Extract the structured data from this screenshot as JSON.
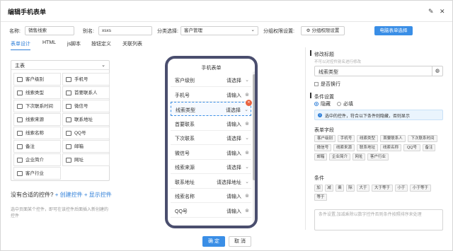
{
  "window": {
    "title": "编辑手机表单"
  },
  "form": {
    "name_label": "名称:",
    "name_value": "销售线索",
    "alias_label": "别名:",
    "alias_value": "xsxs",
    "category_label": "分类选择:",
    "category_value": "客户管理",
    "perm_label": "分组权限设置:",
    "perm_button": "分组权限设置",
    "pc_button": "电脑表单选择"
  },
  "tabs": [
    "表单设计",
    "HTML",
    "js脚本",
    "按钮定义",
    "关联列表"
  ],
  "left_panel": {
    "title": "主表",
    "controls": [
      "客户级别",
      "手机号",
      "线索类型",
      "首要联系人",
      "下次联系时间",
      "微信号",
      "线索来源",
      "联系地址",
      "线索名称",
      "QQ号",
      "备注",
      "邮箱",
      "企业简介",
      "网址",
      "客户行业"
    ],
    "no_fit_text": "没有合适的控件?",
    "create_link": "+ 创建控件",
    "show_link": "+ 显示控件",
    "hint": "选中页面某个控件，即可在该控件后面插入新创建的控件"
  },
  "phone": {
    "title": "手机表单",
    "rows": [
      {
        "label": "客户级别",
        "value": "请选择",
        "mark": "chevron"
      },
      {
        "label": "手机号",
        "value": "请输入",
        "mark": "clear"
      },
      {
        "label": "线索类型",
        "value": "请选择",
        "mark": "chevron",
        "selected": true
      },
      {
        "label": "首要联系",
        "value": "请输入",
        "mark": "clear"
      },
      {
        "label": "下次联系",
        "value": "请选择",
        "mark": "chevron"
      },
      {
        "label": "微信号",
        "value": "请输入",
        "mark": "clear"
      },
      {
        "label": "线索来源",
        "value": "请选择",
        "mark": "chevron"
      },
      {
        "label": "联系地址",
        "value": "请选择地址",
        "mark": "chevron"
      },
      {
        "label": "线索名称",
        "value": "请输入",
        "mark": "clear"
      },
      {
        "label": "QQ号",
        "value": "请输入",
        "mark": "clear"
      }
    ]
  },
  "right_panel": {
    "modify_title": "修改标题",
    "modify_sub": "不可以对控件别名进行修改",
    "title_value": "线索类型",
    "newline_label": "是否换行",
    "cond_label": "条件设置",
    "radio_hide": "隐藏",
    "radio_required": "必填",
    "info_text": "选中的控件，符合以下条件则隐藏，否则显示",
    "fields_label": "表单字段",
    "fields": [
      "客户级别",
      "手机号",
      "线索类型",
      "首要联系人",
      "下次联系时间",
      "微信号",
      "线索来源",
      "联系地址",
      "线索名称",
      "QQ号",
      "备注",
      "邮箱",
      "企业简介",
      "网址",
      "客户行业"
    ],
    "cond2_label": "条件",
    "ops": [
      "加",
      "减",
      "乘",
      "除",
      "大于",
      "大于等于",
      "小于",
      "小于等于",
      "等于"
    ],
    "textarea_placeholder": "条件设置,加减乘除以数字控件否则条件按照排序来处理"
  },
  "footer": {
    "ok": "确 定",
    "cancel": "取 消"
  },
  "colors": {
    "primary": "#3a8ee6",
    "phone_border": "#4a4e6e",
    "badge": "#e9623f"
  }
}
